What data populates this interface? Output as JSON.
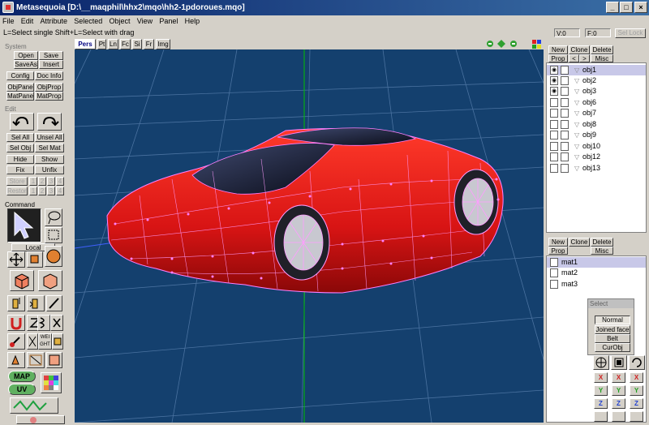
{
  "window": {
    "title": "Metasequoia [D:\\__maqphil\\hhx2\\mqo\\hh2-1pdoroues.mqo]",
    "min_label": "_",
    "max_label": "□",
    "close_label": "×"
  },
  "menu": [
    "File",
    "Edit",
    "Attribute",
    "Selected",
    "Object",
    "View",
    "Panel",
    "Help"
  ],
  "status": {
    "hint": "L=Select single  Shift+L=Select with drag",
    "vertex_count": "V:0",
    "face_count": "F:0",
    "sel_lock": "Sel Lock"
  },
  "system": {
    "label": "System",
    "open": "Open",
    "save": "Save",
    "saveas": "SaveAs",
    "insert": "Insert",
    "config": "Config",
    "docinfo": "Doc Info",
    "objpane": "ObjPane",
    "objprop": "ObjProp",
    "matpane": "MatPane",
    "matprop": "MatProp"
  },
  "edit": {
    "label": "Edit",
    "selall": "Sel All",
    "unselall": "Unsel All",
    "selobj": "Sel Obj",
    "selmat": "Sel Mat",
    "hide": "Hide",
    "show": "Show",
    "fix": "Fix",
    "unfix": "Unfix",
    "store": "Store",
    "restore": "Restore",
    "slot1": "1",
    "slot2": "2",
    "slot3": "3",
    "slot4": "4"
  },
  "command": {
    "label": "Command",
    "local": "Local",
    "weight": "WEI GHT",
    "map": "MAP",
    "uv": "UV"
  },
  "view_tabs": [
    "Pers",
    "Pt",
    "Ln",
    "Fc",
    "Si",
    "Fr",
    "Img"
  ],
  "objects": {
    "new": "New",
    "clone": "Clone",
    "delete": "Delete",
    "prop": "Prop",
    "prev": "<",
    "next": ">",
    "misc": "Misc",
    "items": [
      {
        "name": "obj1",
        "visible": true,
        "selected": true
      },
      {
        "name": "obj2",
        "visible": true,
        "selected": false
      },
      {
        "name": "obj3",
        "visible": true,
        "selected": false
      },
      {
        "name": "obj6",
        "visible": false,
        "selected": false
      },
      {
        "name": "obj7",
        "visible": false,
        "selected": false
      },
      {
        "name": "obj8",
        "visible": false,
        "selected": false
      },
      {
        "name": "obj9",
        "visible": false,
        "selected": false
      },
      {
        "name": "obj10",
        "visible": false,
        "selected": false
      },
      {
        "name": "obj12",
        "visible": false,
        "selected": false
      },
      {
        "name": "obj13",
        "visible": false,
        "selected": false
      }
    ]
  },
  "materials": {
    "new": "New",
    "clone": "Clone",
    "delete": "Delete",
    "prop": "Prop",
    "misc": "Misc",
    "items": [
      {
        "name": "mat1",
        "selected": true
      },
      {
        "name": "mat2",
        "selected": false
      },
      {
        "name": "mat3",
        "selected": false
      }
    ]
  },
  "select_panel": {
    "title": "Select",
    "normal": "Normal",
    "joined": "Joined face",
    "belt": "Belt",
    "curobj": "CurObj"
  },
  "axes": {
    "x": "X",
    "y": "Y",
    "z": "Z"
  },
  "colors": {
    "viewport_bg": "#14406e",
    "car_red": "#e01818",
    "wire": "#ff80ff",
    "axis_green": "#00c000"
  }
}
